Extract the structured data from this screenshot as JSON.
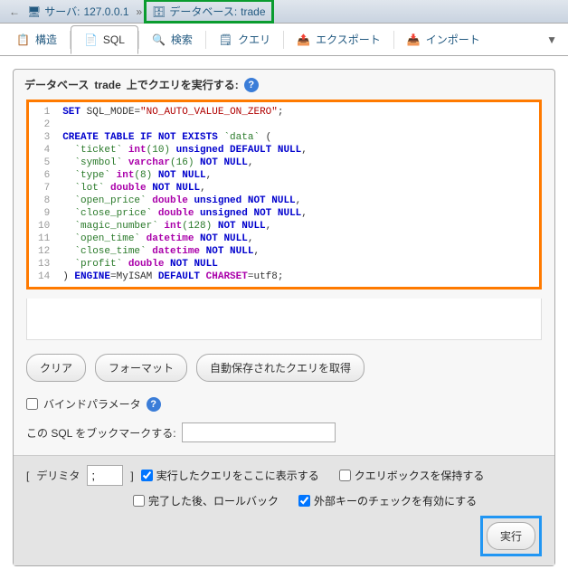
{
  "breadcrumb": {
    "server_label": "サーバ:",
    "server_value": "127.0.0.1",
    "db_label": "データベース:",
    "db_value": "trade"
  },
  "tabs": {
    "structure": "構造",
    "sql": "SQL",
    "search": "検索",
    "query": "クエリ",
    "export": "エクスポート",
    "import": "インポート",
    "more": "▼"
  },
  "panel": {
    "title_prefix": "データベース ",
    "title_db": "trade",
    "title_suffix": " 上でクエリを実行する:"
  },
  "code": {
    "line_count": 14,
    "l1_kw": "SET",
    "l1_var": "SQL_MODE",
    "l1_eq": "=",
    "l1_str": "\"NO_AUTO_VALUE_ON_ZERO\"",
    "l1_end": ";",
    "l3_a": "CREATE TABLE IF NOT EXISTS",
    "l3_id": "`data`",
    "l3_p": " (",
    "l4_id": "  `ticket`",
    "l4_t": " int",
    "l4_n": "(10)",
    "l4_k": " unsigned DEFAULT NULL",
    "l4_c": ",",
    "l5_id": "  `symbol`",
    "l5_t": " varchar",
    "l5_n": "(16)",
    "l5_k": " NOT NULL",
    "l5_c": ",",
    "l6_id": "  `type`",
    "l6_t": " int",
    "l6_n": "(8)",
    "l6_k": " NOT NULL",
    "l6_c": ",",
    "l7_id": "  `lot`",
    "l7_t": " double",
    "l7_k": " NOT NULL",
    "l7_c": ",",
    "l8_id": "  `open_price`",
    "l8_t": " double",
    "l8_k": " unsigned NOT NULL",
    "l8_c": ",",
    "l9_id": "  `close_price`",
    "l9_t": " double",
    "l9_k": " unsigned NOT NULL",
    "l9_c": ",",
    "l10_id": "  `magic_number`",
    "l10_t": " int",
    "l10_n": "(128)",
    "l10_k": " NOT NULL",
    "l10_c": ",",
    "l11_id": "  `open_time`",
    "l11_t": " datetime",
    "l11_k": " NOT NULL",
    "l11_c": ",",
    "l12_id": "  `close_time`",
    "l12_t": " datetime",
    "l12_k": " NOT NULL",
    "l12_c": ",",
    "l13_id": "  `profit`",
    "l13_t": " double",
    "l13_k": " NOT NULL",
    "l14_a": ") ",
    "l14_kw1": "ENGINE",
    "l14_eq1": "=MyISAM ",
    "l14_kw2": "DEFAULT",
    "l14_sp": " ",
    "l14_fn": "CHARSET",
    "l14_eq2": "=utf8;"
  },
  "buttons": {
    "clear": "クリア",
    "format": "フォーマット",
    "get_saved": "自動保存されたクエリを取得"
  },
  "options": {
    "bind_params": "バインドパラメータ",
    "bookmark_label": "この SQL をブックマークする:",
    "delimiter_label": "デリミタ",
    "delimiter_value": ";",
    "show_query": "実行したクエリをここに表示する",
    "retain_box": "クエリボックスを保持する",
    "rollback": "完了した後、ロールバック",
    "fk_check": "外部キーのチェックを有効にする",
    "execute": "実行"
  },
  "brackets": {
    "open": "[",
    "close": "]"
  }
}
